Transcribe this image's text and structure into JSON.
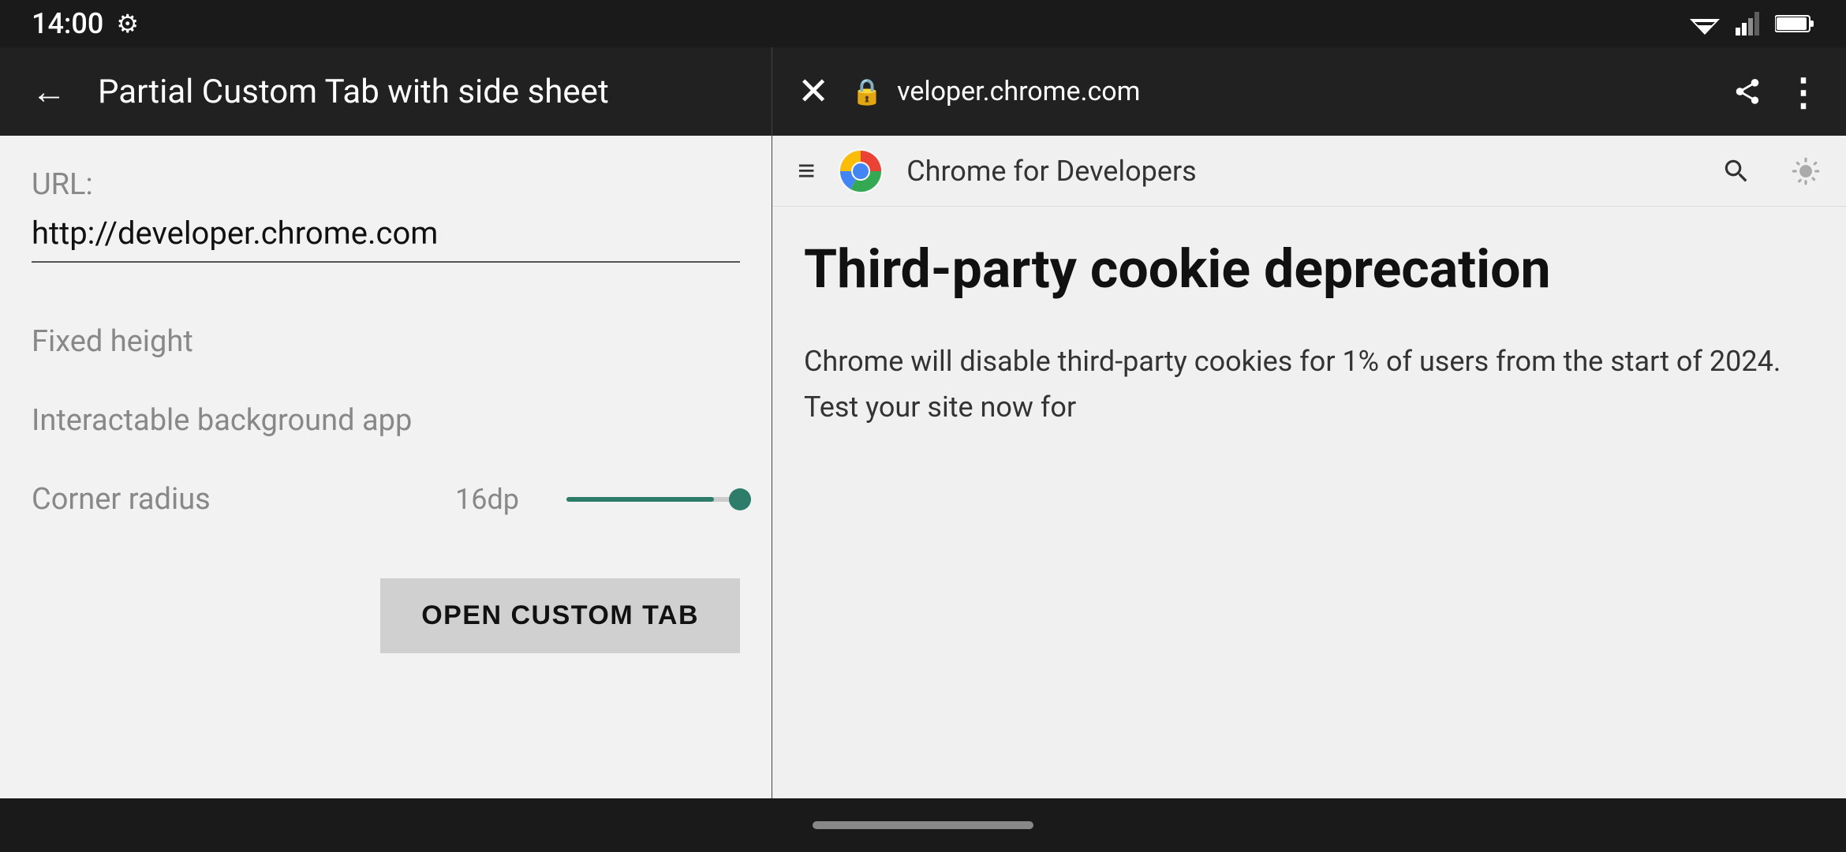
{
  "statusBar": {
    "time": "14:00",
    "gearIcon": "⚙"
  },
  "appToolbar": {
    "backArrow": "←",
    "title": "Partial Custom Tab with side sheet"
  },
  "form": {
    "urlLabel": "URL:",
    "urlValue": "http://developer.chrome.com",
    "fixedHeightLabel": "Fixed height",
    "interactableLabel": "Interactable background app",
    "cornerRadiusLabel": "Corner radius",
    "cornerRadiusValue": "16dp"
  },
  "button": {
    "openCustomTab": "OPEN CUSTOM TAB"
  },
  "chromeToolbar": {
    "closeIcon": "✕",
    "lockIcon": "🔒",
    "addressText": "veloper.chrome.com",
    "shareIcon": "share",
    "menuIcon": "⋮"
  },
  "siteHeader": {
    "hamburger": "≡",
    "siteTitle": "Chrome for Developers",
    "searchIcon": "🔍",
    "brightnessIcon": "☀"
  },
  "article": {
    "title": "Third-party cookie deprecation",
    "body": "Chrome will disable third-party cookies for 1% of users from the start of 2024. Test your site now for"
  }
}
